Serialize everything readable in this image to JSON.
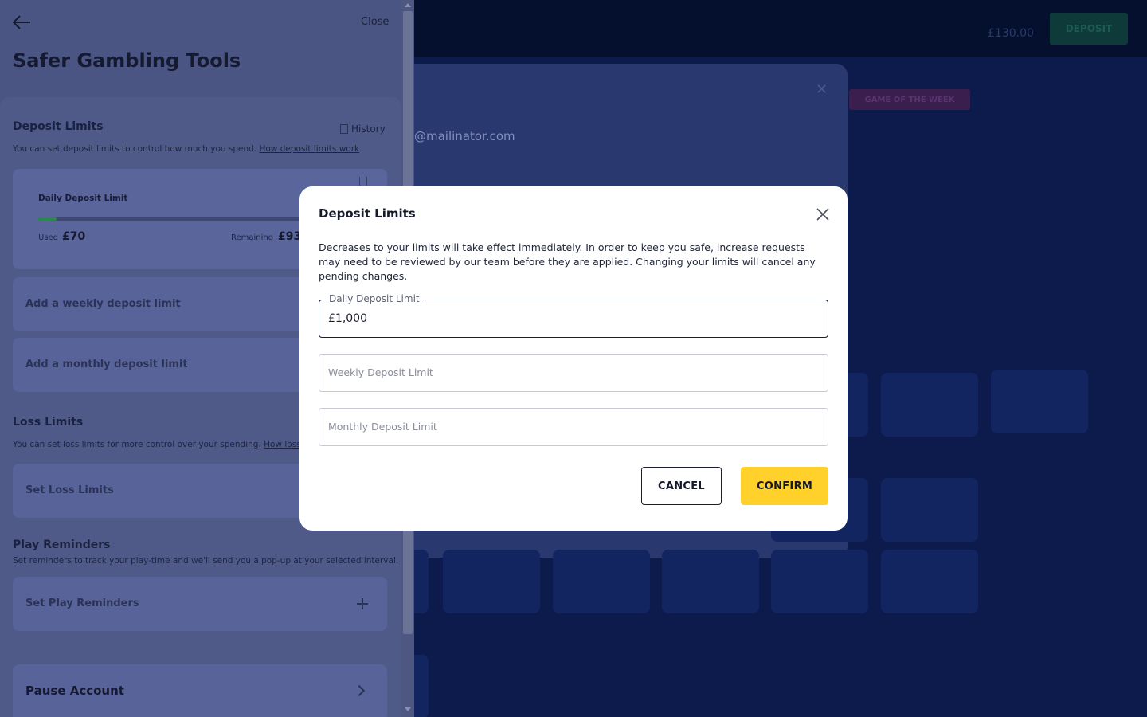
{
  "background": {
    "balance": "£130.00",
    "deposit_label": "DEPOSIT",
    "email_fragment": "@mailinator.com",
    "promo_badge": "GAME OF THE WEEK"
  },
  "panel": {
    "close_label": "Close",
    "title": "Safer Gambling Tools",
    "deposit_limits": {
      "title": "Deposit Limits",
      "history_label": "History",
      "description": "You can set deposit limits to control how much you spend.",
      "link": "How deposit limits work",
      "daily": {
        "title": "Daily Deposit Limit",
        "used_label": "Used",
        "used_value": "£70",
        "remaining_label": "Remaining",
        "remaining_value": "£93",
        "progress": 0.07
      },
      "weekly_add": "Add a weekly deposit limit",
      "monthly_add": "Add a monthly deposit limit"
    },
    "loss_limits": {
      "title": "Loss Limits",
      "description": "You can set loss limits for more control over your spending.",
      "link": "How loss l",
      "action": "Set Loss Limits"
    },
    "play_reminders": {
      "title": "Play Reminders",
      "description": "Set reminders to track your play-time and we'll send you a pop-up at your selected interval.",
      "action": "Set Play Reminders"
    },
    "pause_account": "Pause Account"
  },
  "modal": {
    "title": "Deposit Limits",
    "description": "Decreases to your limits will take effect immediately. In order to keep you safe, increase requests may need to be reviewed by our team before they are applied. Changing your limits will cancel any pending changes.",
    "daily": {
      "label": "Daily Deposit Limit",
      "value": "£1,000"
    },
    "weekly": {
      "placeholder": "Weekly Deposit Limit"
    },
    "monthly": {
      "placeholder": "Monthly Deposit Limit"
    },
    "cancel_label": "CANCEL",
    "confirm_label": "CONFIRM"
  },
  "colors": {
    "confirm_button": "#ffd12a",
    "progress_fill": "#2a8a4a",
    "overlay": "#0a1640"
  }
}
